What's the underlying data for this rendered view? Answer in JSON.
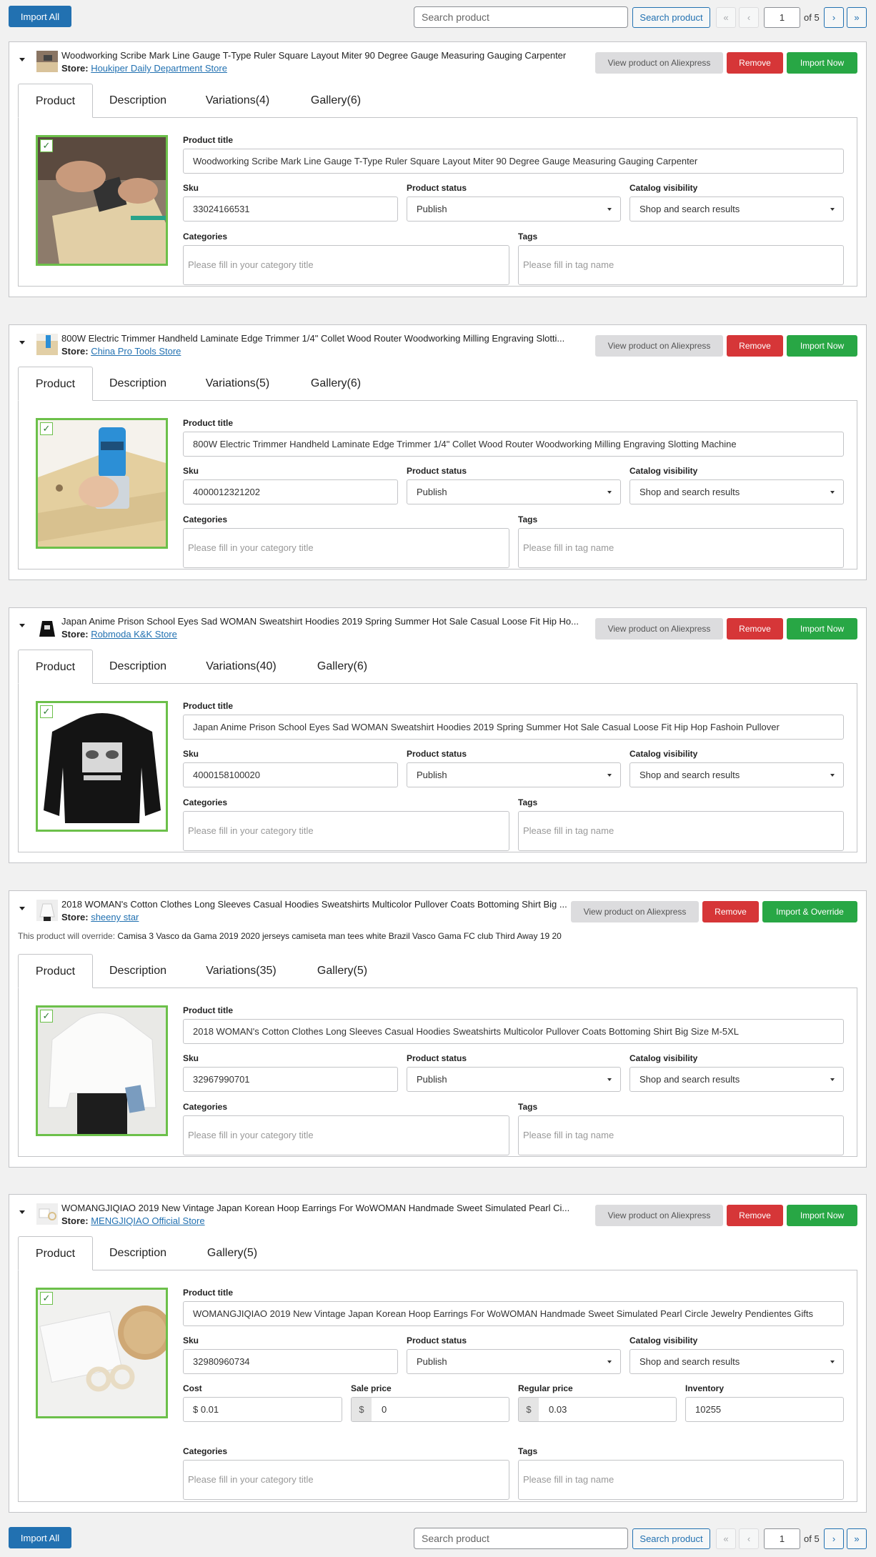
{
  "toolbar": {
    "import_all_label": "Import All",
    "search_placeholder": "Search product",
    "search_button_label": "Search product",
    "first_page": "«",
    "prev_page": "‹",
    "current_page": "1",
    "of_pages": "of 5",
    "next_page": "›",
    "last_page": "»"
  },
  "labels": {
    "store": "Store:",
    "product_title": "Product title",
    "sku": "Sku",
    "product_status": "Product status",
    "catalog_visibility": "Catalog visibility",
    "categories": "Categories",
    "tags": "Tags",
    "categories_placeholder": "Please fill in your category title",
    "tags_placeholder": "Please fill in tag name",
    "view_button": "View product on Aliexpress",
    "remove_button": "Remove",
    "import_now_button": "Import Now",
    "import_override_button": "Import & Override",
    "override_prefix": "This product will override:",
    "cost": "Cost",
    "sale_price": "Sale price",
    "regular_price": "Regular price",
    "inventory": "Inventory",
    "currency": "$"
  },
  "products": [
    {
      "header_title": "Woodworking Scribe Mark Line Gauge T-Type Ruler Square Layout Miter 90 Degree Gauge Measuring Gauging Carpenter",
      "store": "Houkiper Daily Department Store",
      "tabs": [
        "Product",
        "Description",
        "Variations(4)",
        "Gallery(6)"
      ],
      "title": "Woodworking Scribe Mark Line Gauge T-Type Ruler Square Layout Miter 90 Degree Gauge Measuring Gauging Carpenter",
      "sku": "33024166531",
      "status": "Publish",
      "visibility": "Shop and search results",
      "image": "hands-marking-wood-with-gauge"
    },
    {
      "header_title": "800W Electric Trimmer Handheld Laminate Edge Trimmer 1/4\" Collet Wood Router Woodworking Milling Engraving Slotti...",
      "store": "China Pro Tools Store",
      "tabs": [
        "Product",
        "Description",
        "Variations(5)",
        "Gallery(6)"
      ],
      "title": "800W Electric Trimmer Handheld Laminate Edge Trimmer 1/4\" Collet Wood Router Woodworking Milling Engraving Slotting Machine",
      "sku": "4000012321202",
      "status": "Publish",
      "visibility": "Shop and search results",
      "image": "blue-wood-router-on-board"
    },
    {
      "header_title": "Japan Anime Prison School Eyes Sad WOMAN Sweatshirt Hoodies 2019 Spring Summer Hot Sale Casual Loose Fit Hip Ho...",
      "store": "Robmoda K&K Store",
      "tabs": [
        "Product",
        "Description",
        "Variations(40)",
        "Gallery(6)"
      ],
      "title": "Japan Anime Prison School Eyes Sad WOMAN Sweatshirt Hoodies 2019 Spring Summer Hot Sale Casual Loose Fit Hip Hop Fashoin Pullover",
      "sku": "4000158100020",
      "status": "Publish",
      "visibility": "Shop and search results",
      "image": "black-sweatshirt-anime-print"
    },
    {
      "header_title": "2018 WOMAN's Cotton Clothes Long Sleeves Casual Hoodies Sweatshirts Multicolor Pullover Coats Bottoming Shirt Big ...",
      "store": "sheeny star",
      "override_text": "Camisa 3 Vasco da Gama 2019 2020 jerseys camiseta man tees white Brazil Vasco Gama FC club Third Away 19 20",
      "tabs": [
        "Product",
        "Description",
        "Variations(35)",
        "Gallery(5)"
      ],
      "title": "2018 WOMAN's Cotton Clothes Long Sleeves Casual Hoodies Sweatshirts Multicolor Pullover Coats Bottoming Shirt Big Size M-5XL",
      "sku": "32967990701",
      "status": "Publish",
      "visibility": "Shop and search results",
      "image": "person-in-white-sweatshirt"
    },
    {
      "header_title": "WOMANGJIQIAO 2019 New Vintage Japan Korean Hoop Earrings For WoWOMAN Handmade Sweet Simulated Pearl Ci...",
      "store": "MENGJIQIAO Official Store",
      "tabs": [
        "Product",
        "Description",
        "Gallery(5)"
      ],
      "title": "WOMANGJIQIAO 2019 New Vintage Japan Korean Hoop Earrings For WoWOMAN Handmade Sweet Simulated Pearl Circle Jewelry Pendientes Gifts",
      "sku": "32980960734",
      "status": "Publish",
      "visibility": "Shop and search results",
      "cost": "$ 0.01",
      "sale_price": "0",
      "regular_price": "0.03",
      "inventory": "10255",
      "image": "pearl-hoop-earrings-on-card"
    }
  ]
}
